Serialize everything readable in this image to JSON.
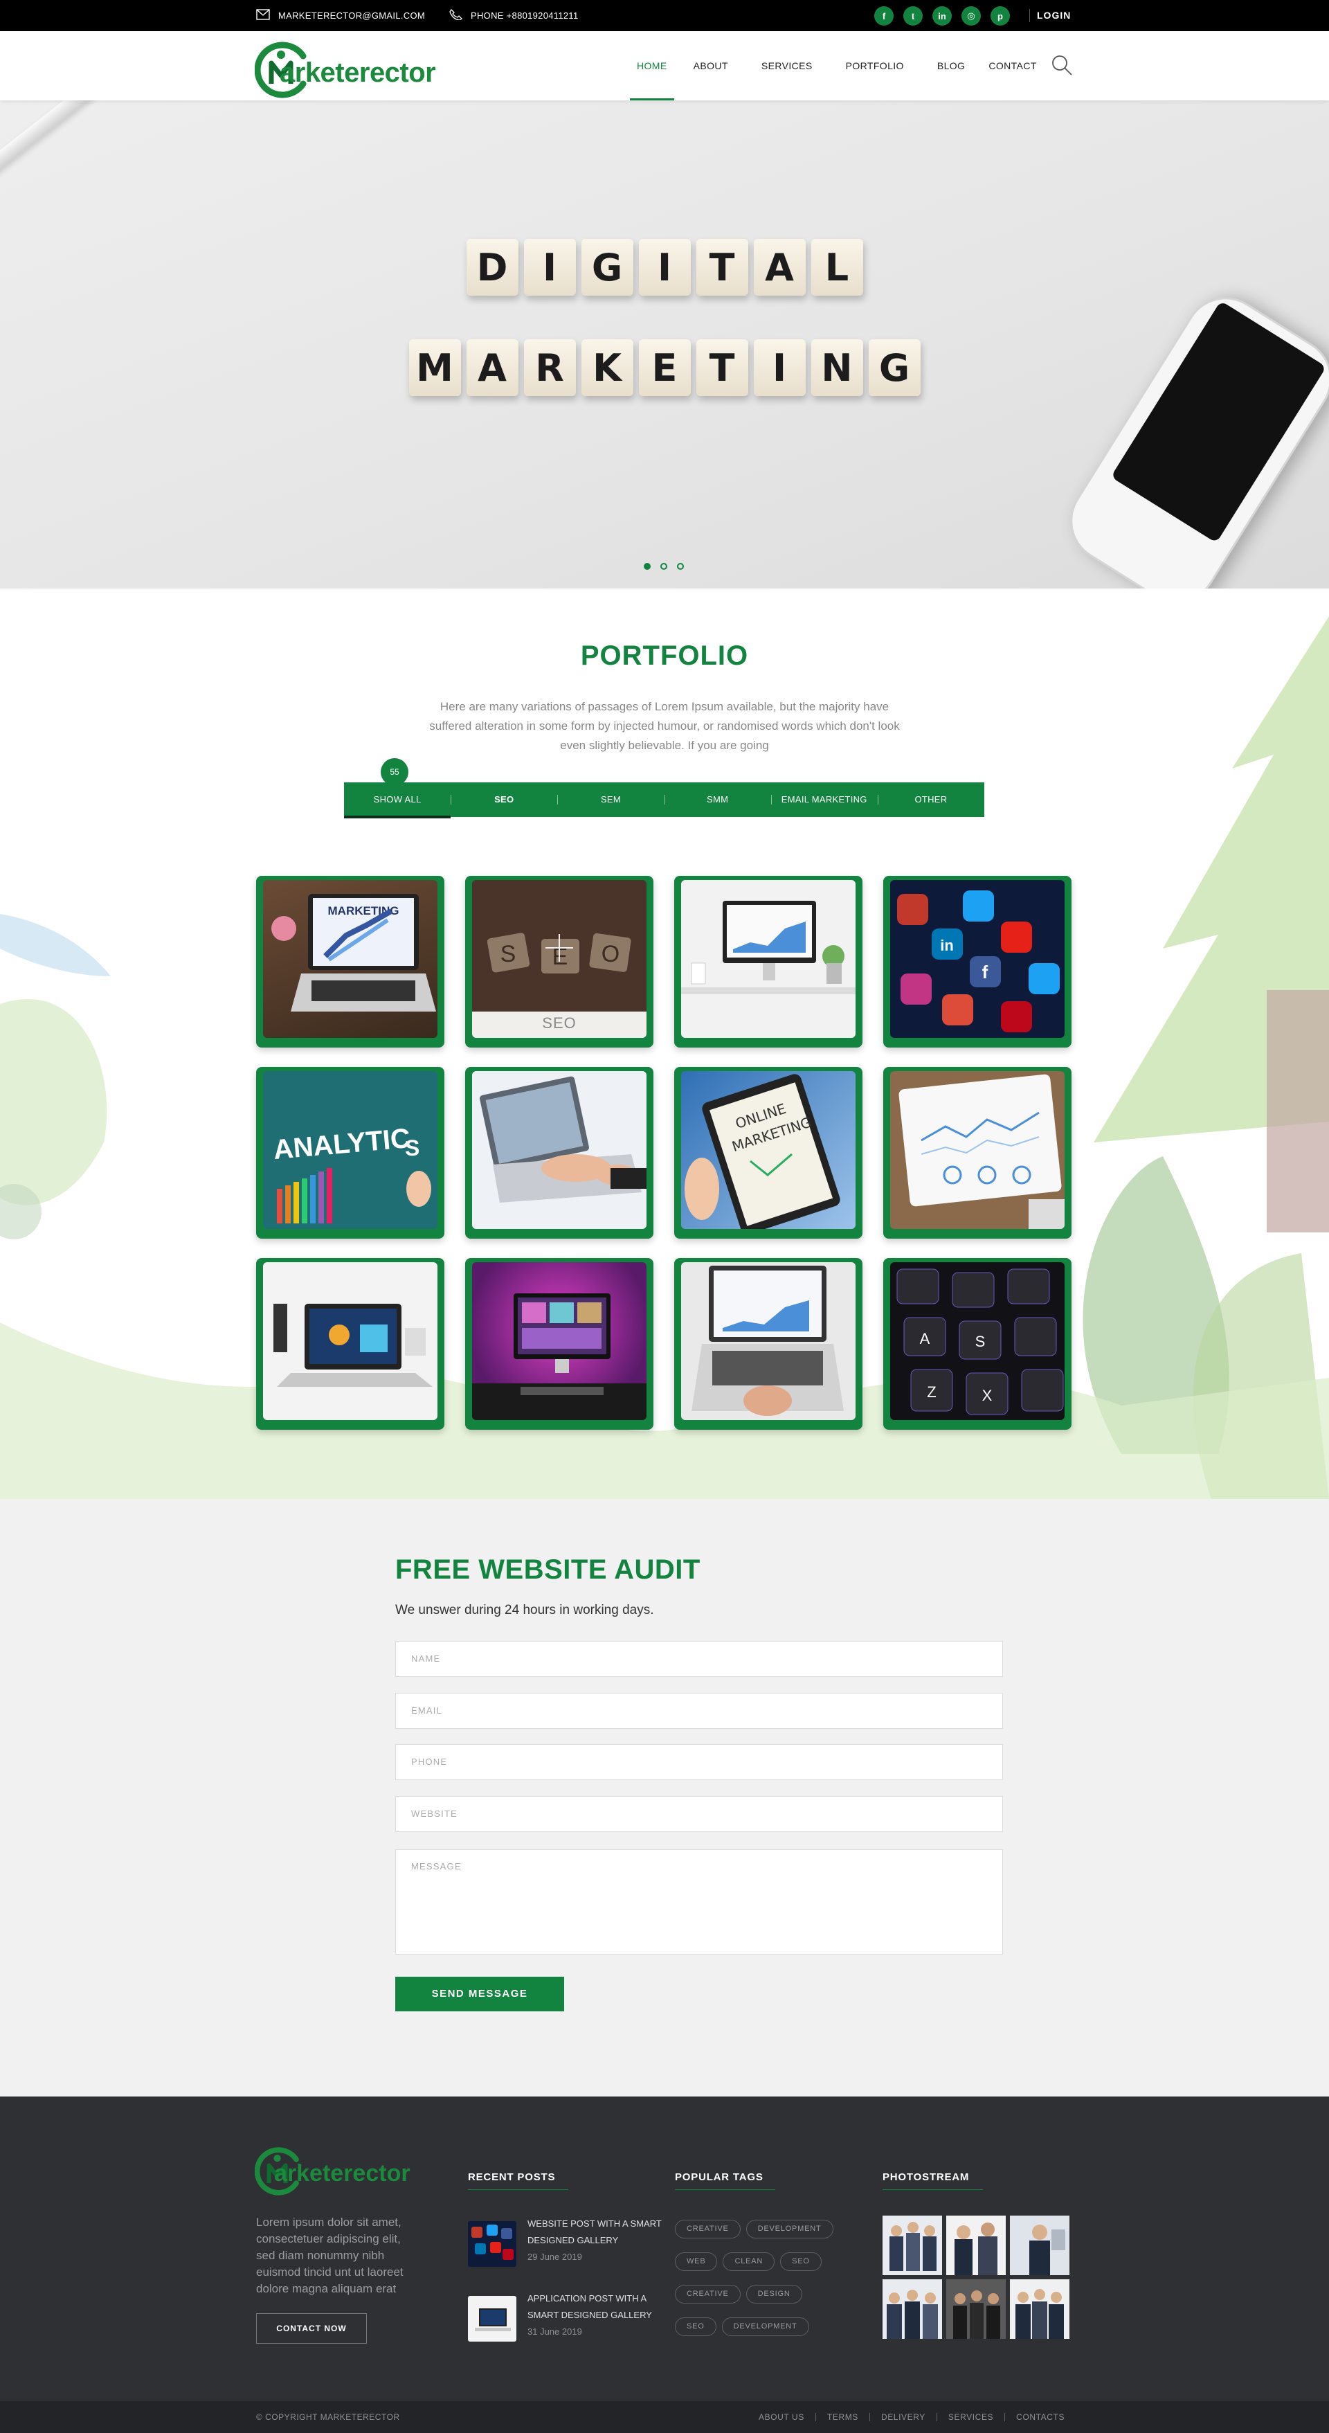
{
  "topbar": {
    "email": "MARKETERECTOR@GMAIL.COM",
    "phone": "PHONE +8801920411211",
    "socials": [
      {
        "icon": "facebook-icon",
        "glyph": "f"
      },
      {
        "icon": "twitter-icon",
        "glyph": "t"
      },
      {
        "icon": "linkedin-icon",
        "glyph": "in"
      },
      {
        "icon": "instagram-icon",
        "glyph": "◎"
      },
      {
        "icon": "pinterest-icon",
        "glyph": "p"
      }
    ],
    "login": "LOGIN"
  },
  "header": {
    "logo_text": "arketerector",
    "nav": [
      {
        "label": "HOME",
        "active": true
      },
      {
        "label": "ABOUT",
        "active": false
      },
      {
        "label": "SERVICES",
        "active": false
      },
      {
        "label": "PORTFOLIO",
        "active": false
      },
      {
        "label": "BLOG",
        "active": false
      },
      {
        "label": "CONTACT",
        "active": false
      }
    ]
  },
  "hero": {
    "line1": "DIGITAL",
    "line2": "MARKETING",
    "slides": 3,
    "active_slide": 1
  },
  "portfolio": {
    "title": "PORTFOLIO",
    "intro": "Here are many variations of passages of Lorem Ipsum available, but the majority have suffered alteration in some form by injected humour, or randomised words which don't look even slightly believable. If you are going",
    "count_badge": "55",
    "filters": [
      {
        "label": "SHOW ALL",
        "active": true
      },
      {
        "label": "SEO",
        "active": false
      },
      {
        "label": "SEM",
        "active": false
      },
      {
        "label": "SMM",
        "active": false
      },
      {
        "label": "EMAIL MARKETING",
        "active": false
      },
      {
        "label": "OTHER",
        "active": false
      }
    ],
    "hover_label": "SEO"
  },
  "audit": {
    "title": "FREE WEBSITE AUDIT",
    "subtitle": "We unswer during 24 hours in working days.",
    "fields": {
      "name": "NAME",
      "email": "EMAIL",
      "phone": "PHONE",
      "website": "WEBSITE",
      "message": "MESSAGE"
    },
    "button": "SEND MESSAGE"
  },
  "footer": {
    "logo_text": "arketerector",
    "about": "Lorem ipsum dolor sit amet, consectetuer adipiscing elit, sed diam nonummy nibh euismod tincid  unt ut laoreet dolore magna aliquam erat",
    "contact_button": "CONTACT NOW",
    "recent_posts_title": "RECENT POSTS",
    "posts": [
      {
        "title": "WEBSITE POST WITH A SMART DESIGNED GALLERY",
        "date": "29 June 2019"
      },
      {
        "title": "APPLICATION POST WITH A SMART DESIGNED GALLERY",
        "date": "31 June 2019"
      }
    ],
    "tags_title": "POPULAR TAGS",
    "tags": [
      "CREATIVE",
      "DEVELOPMENT",
      "WEB",
      "CLEAN",
      "SEO",
      "CREATIVE",
      "DESIGN",
      "SEO",
      "DEVELOPMENT"
    ],
    "photostream_title": "PHOTOSTREAM",
    "copyright": "© COPYRIGHT MARKETERECTOR",
    "links": [
      "ABOUT US",
      "TERMS",
      "DELIVERY",
      "SERVICES",
      "CONTACTS"
    ]
  },
  "colors": {
    "brand_green": "#13843f",
    "topbar_bg": "#000000",
    "footer_bg": "#2e3034",
    "audit_bg": "#f1f1f1"
  }
}
